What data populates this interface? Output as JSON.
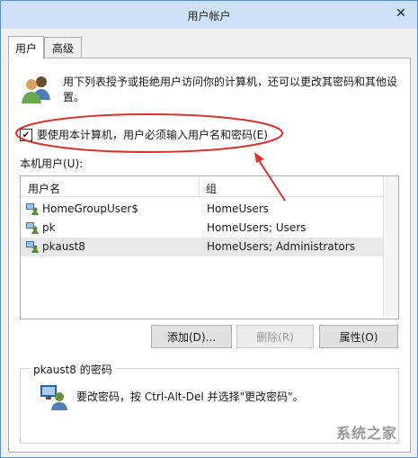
{
  "window": {
    "title": "用户帐户"
  },
  "tabs": [
    {
      "label": "用户"
    },
    {
      "label": "高级"
    }
  ],
  "users_tab": {
    "description": "用下列表授予或拒绝用户访问你的计算机，还可以更改其密码和其他设置。",
    "require_login_label": "要使用本计算机，用户必须输入用户名和密码(E)",
    "require_login_checked": true,
    "local_users_label": "本机用户(U):",
    "columns": {
      "name": "用户名",
      "group": "组"
    },
    "rows": [
      {
        "name": "HomeGroupUser$",
        "group": "HomeUsers"
      },
      {
        "name": "pk",
        "group": "HomeUsers; Users"
      },
      {
        "name": "pkaust8",
        "group": "HomeUsers; Administrators"
      }
    ],
    "buttons": {
      "add": "添加(D)...",
      "remove": "删除(R)",
      "properties": "属性(O)"
    },
    "password_group": {
      "title": "pkaust8 的密码",
      "text": "要改密码，按 Ctrl-Alt-Del 并选择\"更改密码\"。"
    }
  },
  "watermark": "系统之家"
}
